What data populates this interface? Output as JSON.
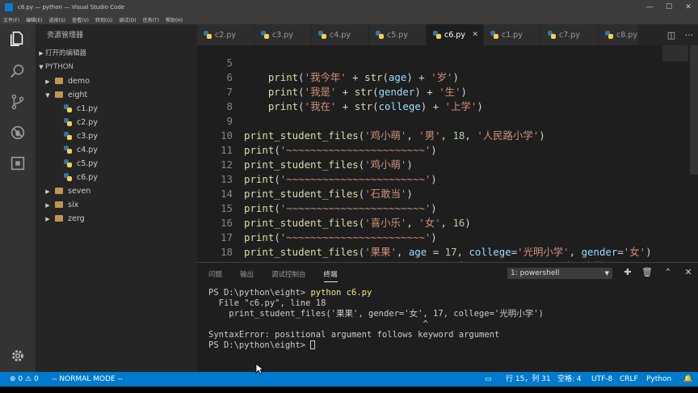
{
  "window": {
    "title": "c6.py — python — Visual Studio Code",
    "controls": [
      "—",
      "☐",
      "✕"
    ]
  },
  "menu": [
    "文件(F)",
    "编辑(E)",
    "选择(S)",
    "查看(V)",
    "转到(G)",
    "调试(D)",
    "任务(T)",
    "帮助(H)"
  ],
  "activity_icons": [
    "files-icon",
    "search-icon",
    "source-control-icon",
    "debug-icon",
    "extensions-icon",
    "settings-gear-icon"
  ],
  "sidebar": {
    "title": "资源管理器",
    "open_editors": "打开的编辑器",
    "root": "PYTHON",
    "tree": [
      {
        "label": "demo",
        "type": "folder",
        "expanded": false
      },
      {
        "label": "eight",
        "type": "folder",
        "expanded": true
      },
      {
        "label": "c1.py",
        "type": "file"
      },
      {
        "label": "c2.py",
        "type": "file"
      },
      {
        "label": "c3.py",
        "type": "file"
      },
      {
        "label": "c4.py",
        "type": "file"
      },
      {
        "label": "c5.py",
        "type": "file"
      },
      {
        "label": "c6.py",
        "type": "file"
      },
      {
        "label": "seven",
        "type": "folder",
        "expanded": false
      },
      {
        "label": "six",
        "type": "folder",
        "expanded": false
      },
      {
        "label": "zerg",
        "type": "folder",
        "expanded": false
      }
    ]
  },
  "tabs": [
    {
      "label": "c2.py",
      "active": false
    },
    {
      "label": "c3.py",
      "active": false
    },
    {
      "label": "c4.py",
      "active": false
    },
    {
      "label": "c5.py",
      "active": false
    },
    {
      "label": "c6.py",
      "active": true
    },
    {
      "label": "c1.py",
      "active": false
    },
    {
      "label": "c7.py",
      "active": false
    },
    {
      "label": "c8.py",
      "active": false
    }
  ],
  "editor": {
    "lines": [
      {
        "n": "5",
        "src": "    print('我今年' + str(age) + '岁')"
      },
      {
        "n": "6",
        "src": "    print('我是' + str(gender) + '生')"
      },
      {
        "n": "7",
        "src": "    print('我在' + str(college) + '上学')"
      },
      {
        "n": "8",
        "src": ""
      },
      {
        "n": "9",
        "src": "print_student_files('鸡小萌', '男', 18, '人民路小学')"
      },
      {
        "n": "10",
        "src": "print('~~~~~~~~~~~~~~~~~~~~~~~')"
      },
      {
        "n": "11",
        "src": "print_student_files('鸡小萌')"
      },
      {
        "n": "12",
        "src": "print('~~~~~~~~~~~~~~~~~~~~~~~')"
      },
      {
        "n": "13",
        "src": "print_student_files('石敢当')"
      },
      {
        "n": "14",
        "src": "print('~~~~~~~~~~~~~~~~~~~~~~~')"
      },
      {
        "n": "15",
        "src": "print_student_files('喜小乐', '女', 16)"
      },
      {
        "n": "16",
        "src": "print('~~~~~~~~~~~~~~~~~~~~~~~')"
      },
      {
        "n": "17",
        "src": "print_student_files('果果', age = 17, college='光明小学', gender='女')"
      },
      {
        "n": "18",
        "src": "print_student_files('果果', gender='女', 17, college='光明小学')"
      }
    ]
  },
  "panel": {
    "tabs": [
      "问题",
      "输出",
      "调试控制台",
      "终端"
    ],
    "active_tab": "终端",
    "terminal_select": "1: powershell",
    "terminal_lines": [
      {
        "prompt": "PS D:\\python\\eight> ",
        "cmd": "python c6.py"
      },
      {
        "text": "  File \"c6.py\", line 18"
      },
      {
        "text": "    print_student_files('果果', gender='女', 17, college='光明小学')"
      },
      {
        "text": "                                          ^"
      },
      {
        "text": "SyntaxError: positional argument follows keyword argument"
      },
      {
        "prompt": "PS D:\\python\\eight> ",
        "cmd": ""
      }
    ]
  },
  "statusbar": {
    "errors": "0",
    "warnings": "0",
    "mode": "-- NORMAL MODE --",
    "position": "行 15，列 31",
    "spaces": "空格: 4",
    "encoding": "UTF-8",
    "eol": "CRLF",
    "language": "Python"
  },
  "colors": {
    "statusbar": "#007acc",
    "editor_bg": "#1e1e1e",
    "sidebar_bg": "#252526",
    "activity_bg": "#333333"
  }
}
